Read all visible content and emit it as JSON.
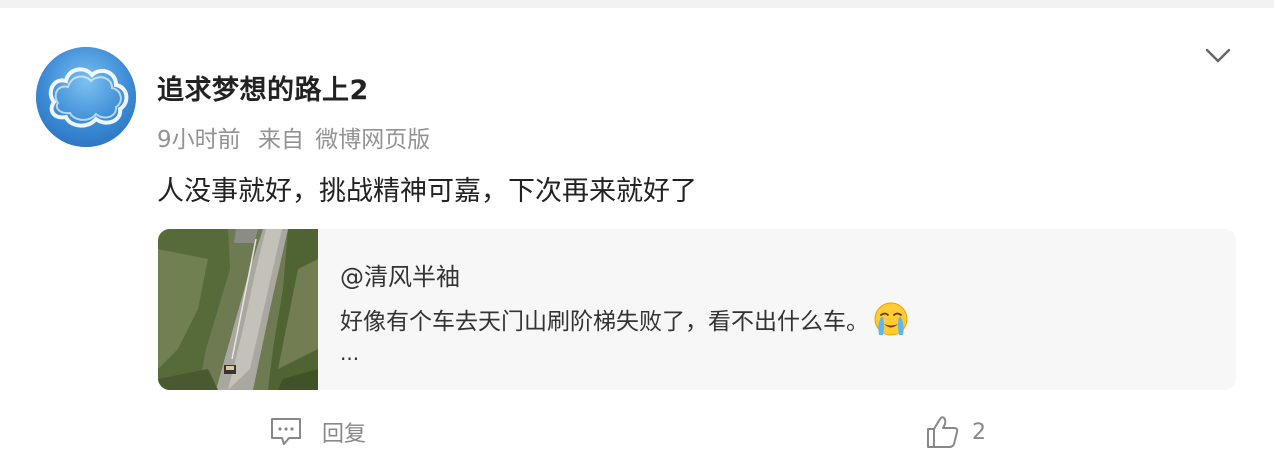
{
  "comment": {
    "username": "追求梦想的路上2",
    "time": "9小时前",
    "source_prefix": "来自",
    "source": "微博网页版",
    "text": "人没事就好，挑战精神可嘉，下次再来就好了"
  },
  "quoted_post": {
    "author": "@清风半袖",
    "text": "好像有个车去天门山刷阶梯失败了，看不出什么车。",
    "ellipsis": "...",
    "emoji_icon": "crying-face-emoji"
  },
  "actions": {
    "reply_label": "回复",
    "like_count": "2"
  },
  "icons": {
    "menu": "chevron-down-icon",
    "reply": "comment-icon",
    "like": "thumbs-up-icon"
  },
  "colors": {
    "meta_gray": "#939393",
    "card_bg": "#f7f7f7"
  }
}
